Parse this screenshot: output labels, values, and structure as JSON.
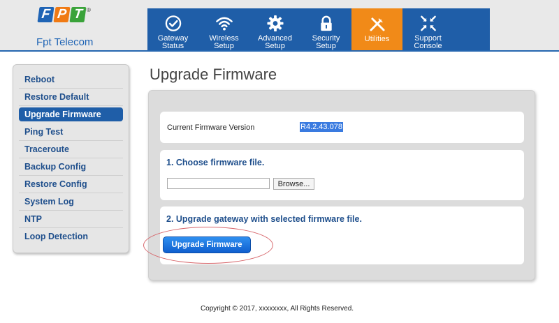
{
  "logo": {
    "letters": [
      "F",
      "P",
      "T"
    ],
    "registered": "®",
    "name": "Fpt Telecom"
  },
  "nav": {
    "items": [
      {
        "label": "Gateway\nStatus",
        "icon": "check-circle-icon"
      },
      {
        "label": "Wireless\nSetup",
        "icon": "wifi-icon"
      },
      {
        "label": "Advanced\nSetup",
        "icon": "gear-icon"
      },
      {
        "label": "Security\nSetup",
        "icon": "lock-icon"
      },
      {
        "label": "Utilities",
        "icon": "tools-icon",
        "active": true
      },
      {
        "label": "Support\nConsole",
        "icon": "compress-arrows-icon"
      }
    ]
  },
  "sidebar": {
    "items": [
      {
        "label": "Reboot"
      },
      {
        "label": "Restore Default"
      },
      {
        "label": "Upgrade Firmware",
        "active": true
      },
      {
        "label": "Ping Test"
      },
      {
        "label": "Traceroute"
      },
      {
        "label": "Backup Config"
      },
      {
        "label": "Restore Config"
      },
      {
        "label": "System Log"
      },
      {
        "label": "NTP"
      },
      {
        "label": "Loop Detection"
      }
    ]
  },
  "main": {
    "title": "Upgrade Firmware",
    "current_label": "Current Firmware Version",
    "current_value": "R4.2.43.078",
    "step1_title": "1. Choose firmware file.",
    "file_value": "",
    "browse_label": "Browse...",
    "step2_title": "2. Upgrade gateway with selected firmware file.",
    "upgrade_label": "Upgrade Firmware"
  },
  "footer": {
    "text": "Copyright © 2017, xxxxxxxx, All Rights Reserved."
  },
  "colors": {
    "nav_bg": "#1f5ea8",
    "nav_active": "#f18a18",
    "sidebar_text": "#1f4f8c",
    "highlight_ring": "#d7656a"
  }
}
